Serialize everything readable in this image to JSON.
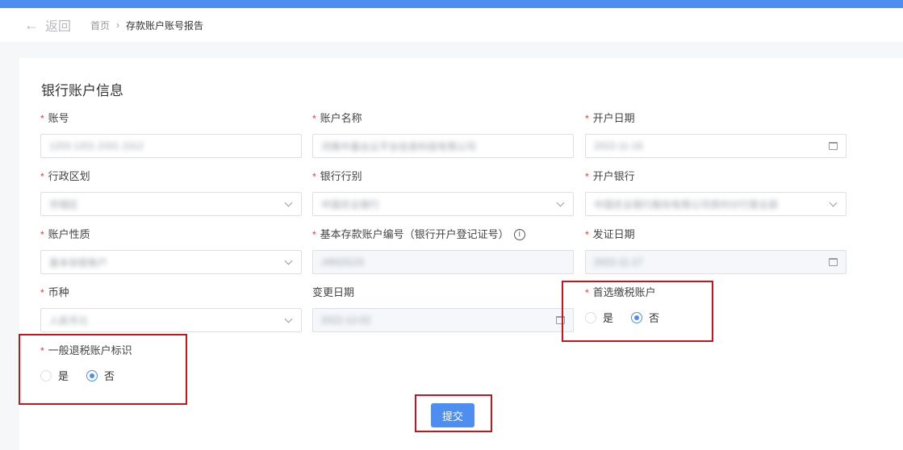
{
  "nav": {
    "back_label": "返回",
    "breadcrumb": [
      "首页",
      "存款账户账号报告"
    ]
  },
  "section_title": "银行账户信息",
  "fields": {
    "account_no": {
      "label": "账号",
      "value": "1203 1201 2331 2312"
    },
    "account_name": {
      "label": "账户名称",
      "value": "河南中基台云平台信息科技有限公司"
    },
    "open_date": {
      "label": "开户日期",
      "value": "2022-11-18"
    },
    "admin_region": {
      "label": "行政区划",
      "value": "市辖区"
    },
    "bank_type": {
      "label": "银行行别",
      "value": "中国农业银行"
    },
    "open_bank": {
      "label": "开户银行",
      "value": "中国农业银行股份有限公司郑州分行营业部"
    },
    "account_nature": {
      "label": "账户性质",
      "value": "基本存款账户"
    },
    "basic_account_no": {
      "label": "基本存款账户编号（银行开户登记证号）",
      "value": "J4910123"
    },
    "issue_date": {
      "label": "发证日期",
      "value": "2022-11-17"
    },
    "currency": {
      "label": "币种",
      "value": "人民币元"
    },
    "change_date": {
      "label": "变更日期",
      "value": "2022-12-02"
    }
  },
  "preferred_tax_account": {
    "label": "首选缴税账户",
    "options": [
      "是",
      "否"
    ],
    "selected": "否"
  },
  "general_refund_flag": {
    "label": "一般退税账户标识",
    "options": [
      "是",
      "否"
    ],
    "selected": "否"
  },
  "submit_label": "提交",
  "colors": {
    "primary": "#4d8ef0",
    "required": "#e4393c",
    "highlight": "#c4161c"
  }
}
